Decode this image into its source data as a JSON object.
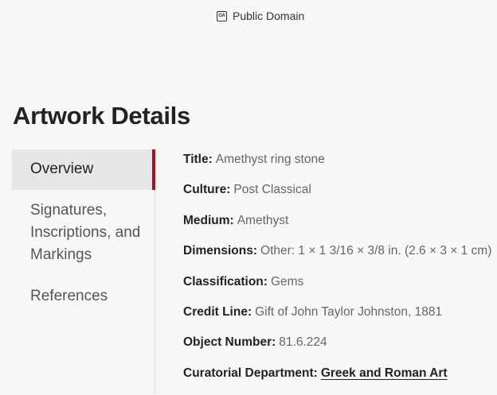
{
  "license": {
    "icon": "open-access-icon",
    "icon_glyph": "OA",
    "text": "Public Domain"
  },
  "section_title": "Artwork Details",
  "nav": {
    "accent_color": "#a3141e",
    "items": [
      {
        "label": "Overview",
        "active": true
      },
      {
        "label": "Signatures, Inscriptions, and Markings",
        "active": false
      },
      {
        "label": "References",
        "active": false
      }
    ]
  },
  "details": {
    "title": {
      "label": "Title:",
      "value": "Amethyst ring stone"
    },
    "culture": {
      "label": "Culture:",
      "value": "Post Classical"
    },
    "medium": {
      "label": "Medium:",
      "value": "Amethyst"
    },
    "dimensions": {
      "label": "Dimensions:",
      "value": "Other: 1 × 1 3/16 × 3/8 in. (2.6 × 3 × 1 cm)"
    },
    "classification": {
      "label": "Classification:",
      "value": "Gems"
    },
    "credit_line": {
      "label": "Credit Line:",
      "value": "Gift of John Taylor Johnston, 1881"
    },
    "object_number": {
      "label": "Object Number:",
      "value": "81.6.224"
    },
    "department": {
      "label": "Curatorial Department:",
      "value": "Greek and Roman Art"
    }
  }
}
